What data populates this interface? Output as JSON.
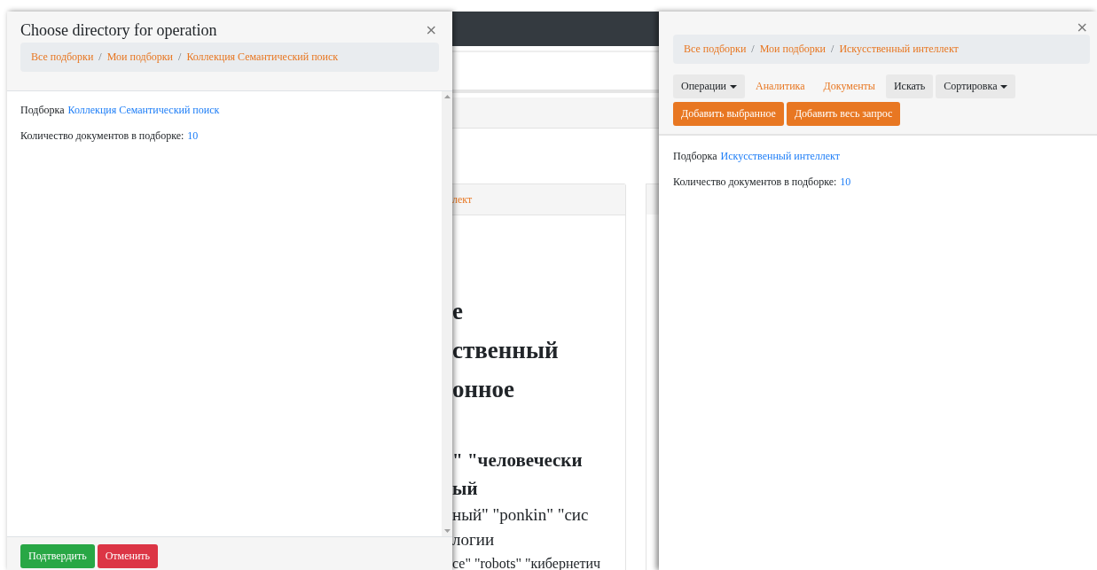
{
  "background_page": {
    "card_header": "лект",
    "lines": [
      {
        "text": "е",
        "kind": "heading"
      },
      {
        "text": "ственный",
        "kind": "heading"
      },
      {
        "text": "онное",
        "kind": "heading"
      },
      {
        "text": "\" \"человечески",
        "kind": "subheading"
      },
      {
        "text": "ый",
        "kind": "subheading"
      },
      {
        "text": "ный\" \"ponkin\" \"сис",
        "kind": "body"
      },
      {
        "text": "логии",
        "kind": "body"
      },
      {
        "text": "се\" \"robots\" \"кибернетич",
        "kind": "small"
      }
    ]
  },
  "left_dialog": {
    "title": "Choose directory for operation",
    "close": "×",
    "breadcrumbs": [
      "Все подборки",
      "Мои подборки",
      "Коллекция Семантический поиск"
    ],
    "breadcrumb_separator": "/",
    "collection_label": "Подборка",
    "collection_link": "Коллекция Семантический поиск",
    "count_label": "Количество документов в подборке:",
    "count_value": "10",
    "buttons": [
      {
        "label": "Подтвердить",
        "kind": "success"
      },
      {
        "label": "Отменить",
        "kind": "danger"
      }
    ]
  },
  "right_panel": {
    "close": "×",
    "breadcrumbs": [
      "Все подборки",
      "Мои подборки",
      "Искусственный интеллект"
    ],
    "breadcrumb_separator": "/",
    "toolbar": [
      {
        "label": "Операции",
        "kind": "dropdown"
      },
      {
        "label": "Аналитика",
        "kind": "link"
      },
      {
        "label": "Документы",
        "kind": "link"
      },
      {
        "label": "Искать",
        "kind": "button"
      },
      {
        "label": "Сортировка",
        "kind": "dropdown"
      }
    ],
    "actions": [
      "Добавить выбранное",
      "Добавить весь запрос"
    ],
    "collection_label": "Подборка",
    "collection_link": "Искусственный интеллект",
    "count_label": "Количество документов в подборке:",
    "count_value": "10"
  }
}
